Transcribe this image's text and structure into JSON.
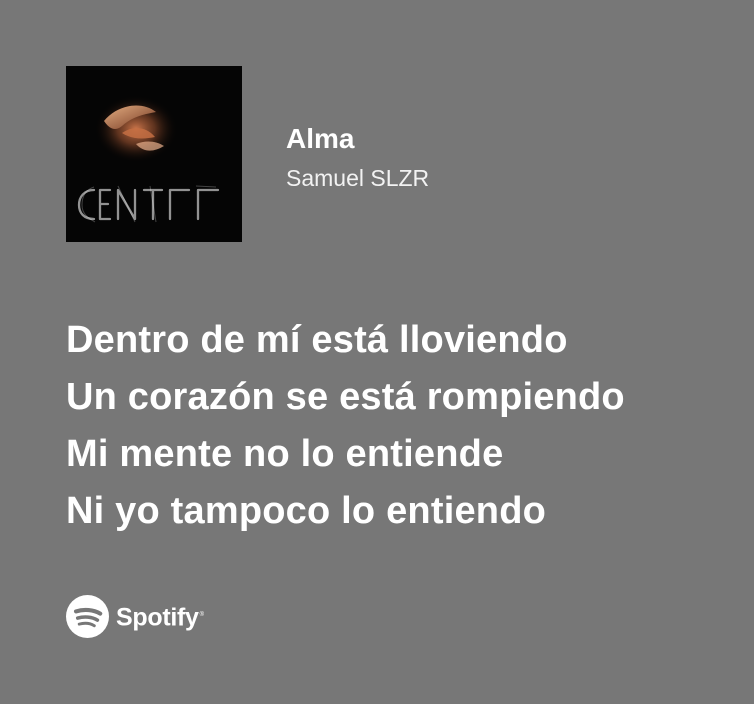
{
  "theme": {
    "background": "#777777",
    "text": "#ffffff",
    "artwork_bg": "#060606"
  },
  "track": {
    "title": "Alma",
    "artist": "Samuel SLZR",
    "artwork_icon": "album-cover"
  },
  "lyrics": [
    "Dentro de mí está lloviendo",
    "Un corazón se está rompiendo",
    "Mi mente no lo entiende",
    "Ni yo tampoco lo entiendo"
  ],
  "branding": {
    "name": "Spotify",
    "trademark": "®",
    "icon": "spotify-logo-icon"
  }
}
